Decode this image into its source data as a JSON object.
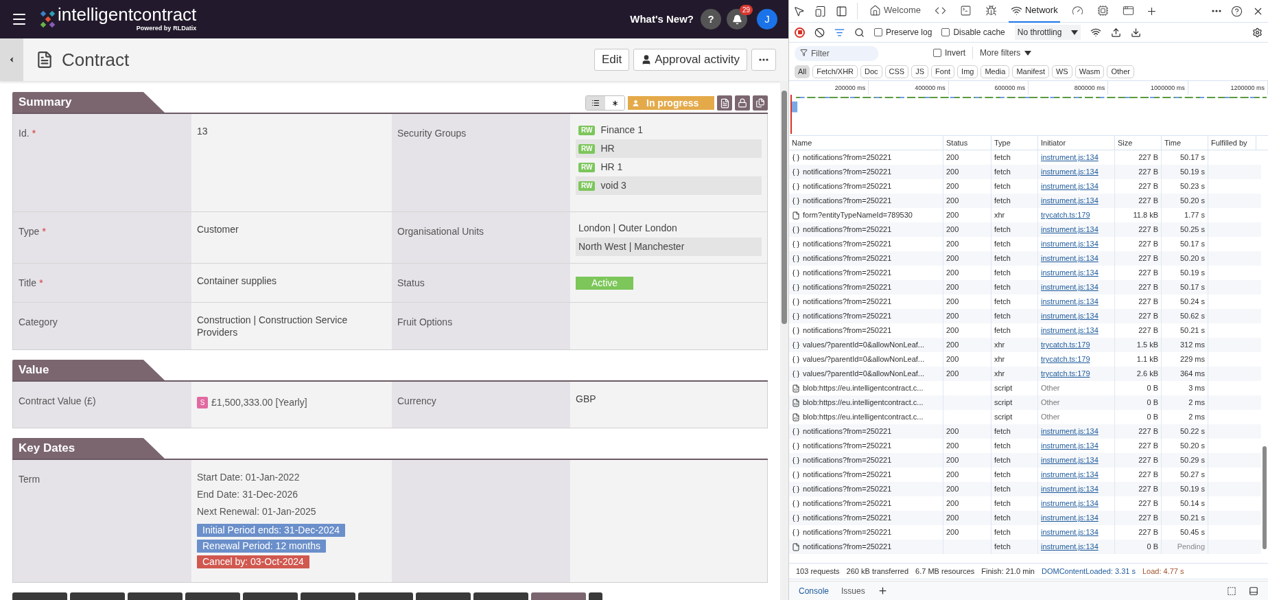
{
  "app_header": {
    "logo_text": "intelligentcontract",
    "powered_by": "Powered by",
    "brand": "RLDatix",
    "whats_new": "What's New?",
    "help": "?",
    "notification_count": "29",
    "avatar": "J"
  },
  "title_bar": {
    "title": "Contract",
    "buttons": [
      {
        "kind": "text",
        "label": "Edit"
      },
      {
        "kind": "approval",
        "label": "Approval activity"
      }
    ]
  },
  "summary_tools": {
    "views": [
      {
        "kind": "list",
        "selected": true
      },
      {
        "kind": "asterisk",
        "selected": false
      }
    ],
    "status_badge": "In progress"
  },
  "sections": [
    {
      "title": "Summary",
      "rows": [
        [
          {
            "label": "Id.",
            "required_mark": "*",
            "value": {
              "kind": "text",
              "text": "13"
            }
          },
          {
            "label": "Security Groups",
            "value": {
              "kind": "tags",
              "items": [
                {
                  "tag": "RW",
                  "name": "Finance 1"
                },
                {
                  "tag": "RW",
                  "name": "HR"
                },
                {
                  "tag": "RW",
                  "name": "HR 1"
                },
                {
                  "tag": "RW",
                  "name": "void 3"
                }
              ]
            }
          }
        ],
        [
          {
            "label": "Type",
            "required_mark": "*",
            "value": {
              "kind": "text",
              "text": "Customer"
            }
          },
          {
            "label": "Organisational Units",
            "value": {
              "kind": "list",
              "items": [
                "London | Outer London",
                "North West | Manchester"
              ]
            }
          }
        ],
        [
          {
            "label": "Title",
            "required_mark": "*",
            "value": {
              "kind": "text",
              "text": "Container supplies"
            }
          },
          {
            "label": "Status",
            "value": {
              "kind": "status",
              "text": "Active"
            }
          }
        ],
        [
          {
            "label": "Category",
            "value": {
              "kind": "text",
              "text": "Construction | Construction Service Providers"
            }
          },
          {
            "label": "Fruit Options"
          }
        ]
      ]
    },
    {
      "title": "Value",
      "rows": [
        [
          {
            "label": "Contract Value (£)",
            "value": {
              "kind": "money",
              "symbol": "S",
              "text": "£1,500,333.00 [Yearly]"
            }
          },
          {
            "label": "Currency",
            "value": {
              "kind": "text",
              "text": "GBP"
            }
          }
        ]
      ]
    },
    {
      "title": "Key Dates",
      "rows": [
        [
          {
            "label": "Term",
            "value": {
              "kind": "dates",
              "lines": [
                "Start Date: 01-Jan-2022",
                "End Date: 31-Dec-2026",
                "Next Renewal: 01-Jan-2025"
              ],
              "badges": [
                {
                  "text": "Initial Period ends: 31-Dec-2024",
                  "color": "#6a8fca"
                },
                {
                  "text": "Renewal Period: 12 months",
                  "color": "#6a8fca"
                },
                {
                  "text": "Cancel by: 03-Oct-2024",
                  "color": "#d0584f"
                }
              ]
            }
          }
        ]
      ]
    }
  ],
  "bottom_tabs": [
    {
      "selected": false
    },
    {
      "selected": false
    },
    {
      "selected": false
    },
    {
      "selected": false
    },
    {
      "selected": false
    },
    {
      "selected": false
    },
    {
      "selected": false
    },
    {
      "selected": false
    },
    {
      "selected": false
    },
    {
      "selected": true
    },
    {
      "selected": false
    }
  ],
  "devtools": {
    "panel_tabs": [
      {
        "kind": "welcome",
        "label": "Welcome",
        "selected": false
      },
      {
        "kind": "elements",
        "selected": false
      },
      {
        "kind": "console",
        "selected": false
      },
      {
        "kind": "sources",
        "selected": false
      },
      {
        "kind": "network",
        "label": "Network",
        "selected": true
      },
      {
        "kind": "performance",
        "selected": false
      },
      {
        "kind": "memory",
        "selected": false
      },
      {
        "kind": "application",
        "selected": false
      }
    ],
    "preserve_log": {
      "label": "Preserve log",
      "checked": false
    },
    "disable_cache": {
      "label": "Disable cache",
      "checked": false
    },
    "throttling": "No throttling",
    "filter_placeholder": "Filter",
    "invert": {
      "label": "Invert",
      "checked": false
    },
    "more_filters": "More filters",
    "type_filters": [
      {
        "label": "All",
        "selected": true
      },
      {
        "label": "Fetch/XHR",
        "selected": false
      },
      {
        "label": "Doc",
        "selected": false
      },
      {
        "label": "CSS",
        "selected": false
      },
      {
        "label": "JS",
        "selected": false
      },
      {
        "label": "Font",
        "selected": false
      },
      {
        "label": "Img",
        "selected": false
      },
      {
        "label": "Media",
        "selected": false
      },
      {
        "label": "Manifest",
        "selected": false
      },
      {
        "label": "WS",
        "selected": false
      },
      {
        "label": "Wasm",
        "selected": false
      },
      {
        "label": "Other",
        "selected": false
      }
    ],
    "overview_ticks": [
      "200000 ms",
      "400000 ms",
      "600000 ms",
      "800000 ms",
      "1000000 ms",
      "1200000 ms"
    ],
    "columns": [
      "Name",
      "Status",
      "Type",
      "Initiator",
      "Size",
      "Time",
      "Fulfilled by"
    ],
    "requests": [
      {
        "kind": "fetch",
        "name": "notifications?from=250221",
        "status": "200",
        "type": "fetch",
        "initiator": "instrument.js:134",
        "linked": true,
        "size": "227 B",
        "time": "50.17 s",
        "pending": false
      },
      {
        "kind": "fetch",
        "name": "notifications?from=250221",
        "status": "200",
        "type": "fetch",
        "initiator": "instrument.js:134",
        "linked": true,
        "size": "227 B",
        "time": "50.19 s",
        "pending": false
      },
      {
        "kind": "fetch",
        "name": "notifications?from=250221",
        "status": "200",
        "type": "fetch",
        "initiator": "instrument.js:134",
        "linked": true,
        "size": "227 B",
        "time": "50.23 s",
        "pending": false
      },
      {
        "kind": "fetch",
        "name": "notifications?from=250221",
        "status": "200",
        "type": "fetch",
        "initiator": "instrument.js:134",
        "linked": true,
        "size": "227 B",
        "time": "50.20 s",
        "pending": false
      },
      {
        "kind": "document",
        "name": "form?entityTypeNameId=789530",
        "status": "200",
        "type": "xhr",
        "initiator": "trycatch.ts:179",
        "linked": true,
        "size": "11.8 kB",
        "time": "1.77 s",
        "pending": false
      },
      {
        "kind": "fetch",
        "name": "notifications?from=250221",
        "status": "200",
        "type": "fetch",
        "initiator": "instrument.js:134",
        "linked": true,
        "size": "227 B",
        "time": "50.25 s",
        "pending": false
      },
      {
        "kind": "fetch",
        "name": "notifications?from=250221",
        "status": "200",
        "type": "fetch",
        "initiator": "instrument.js:134",
        "linked": true,
        "size": "227 B",
        "time": "50.17 s",
        "pending": false
      },
      {
        "kind": "fetch",
        "name": "notifications?from=250221",
        "status": "200",
        "type": "fetch",
        "initiator": "instrument.js:134",
        "linked": true,
        "size": "227 B",
        "time": "50.20 s",
        "pending": false
      },
      {
        "kind": "fetch",
        "name": "notifications?from=250221",
        "status": "200",
        "type": "fetch",
        "initiator": "instrument.js:134",
        "linked": true,
        "size": "227 B",
        "time": "50.19 s",
        "pending": false
      },
      {
        "kind": "fetch",
        "name": "notifications?from=250221",
        "status": "200",
        "type": "fetch",
        "initiator": "instrument.js:134",
        "linked": true,
        "size": "227 B",
        "time": "50.17 s",
        "pending": false
      },
      {
        "kind": "fetch",
        "name": "notifications?from=250221",
        "status": "200",
        "type": "fetch",
        "initiator": "instrument.js:134",
        "linked": true,
        "size": "227 B",
        "time": "50.24 s",
        "pending": false
      },
      {
        "kind": "fetch",
        "name": "notifications?from=250221",
        "status": "200",
        "type": "fetch",
        "initiator": "instrument.js:134",
        "linked": true,
        "size": "227 B",
        "time": "50.62 s",
        "pending": false
      },
      {
        "kind": "fetch",
        "name": "notifications?from=250221",
        "status": "200",
        "type": "fetch",
        "initiator": "instrument.js:134",
        "linked": true,
        "size": "227 B",
        "time": "50.21 s",
        "pending": false
      },
      {
        "kind": "fetch",
        "name": "values/?parentId=0&allowNonLeaf...",
        "status": "200",
        "type": "xhr",
        "initiator": "trycatch.ts:179",
        "linked": true,
        "size": "1.5 kB",
        "time": "312 ms",
        "pending": false
      },
      {
        "kind": "fetch",
        "name": "values/?parentId=0&allowNonLeaf...",
        "status": "200",
        "type": "xhr",
        "initiator": "trycatch.ts:179",
        "linked": true,
        "size": "1.1 kB",
        "time": "229 ms",
        "pending": false
      },
      {
        "kind": "fetch",
        "name": "values/?parentId=0&allowNonLeaf...",
        "status": "200",
        "type": "xhr",
        "initiator": "trycatch.ts:179",
        "linked": true,
        "size": "2.6 kB",
        "time": "364 ms",
        "pending": false
      },
      {
        "kind": "script",
        "name": "blob:https://eu.intelligentcontract.c...",
        "type": "script",
        "initiator": "Other",
        "linked": false,
        "size": "0 B",
        "time": "3 ms",
        "pending": false
      },
      {
        "kind": "script",
        "name": "blob:https://eu.intelligentcontract.c...",
        "type": "script",
        "initiator": "Other",
        "linked": false,
        "size": "0 B",
        "time": "2 ms",
        "pending": false
      },
      {
        "kind": "script",
        "name": "blob:https://eu.intelligentcontract.c...",
        "type": "script",
        "initiator": "Other",
        "linked": false,
        "size": "0 B",
        "time": "2 ms",
        "pending": false
      },
      {
        "kind": "fetch",
        "name": "notifications?from=250221",
        "status": "200",
        "type": "fetch",
        "initiator": "instrument.js:134",
        "linked": true,
        "size": "227 B",
        "time": "50.22 s",
        "pending": false
      },
      {
        "kind": "fetch",
        "name": "notifications?from=250221",
        "status": "200",
        "type": "fetch",
        "initiator": "instrument.js:134",
        "linked": true,
        "size": "227 B",
        "time": "50.20 s",
        "pending": false
      },
      {
        "kind": "fetch",
        "name": "notifications?from=250221",
        "status": "200",
        "type": "fetch",
        "initiator": "instrument.js:134",
        "linked": true,
        "size": "227 B",
        "time": "50.29 s",
        "pending": false
      },
      {
        "kind": "fetch",
        "name": "notifications?from=250221",
        "status": "200",
        "type": "fetch",
        "initiator": "instrument.js:134",
        "linked": true,
        "size": "227 B",
        "time": "50.27 s",
        "pending": false
      },
      {
        "kind": "fetch",
        "name": "notifications?from=250221",
        "status": "200",
        "type": "fetch",
        "initiator": "instrument.js:134",
        "linked": true,
        "size": "227 B",
        "time": "50.19 s",
        "pending": false
      },
      {
        "kind": "fetch",
        "name": "notifications?from=250221",
        "status": "200",
        "type": "fetch",
        "initiator": "instrument.js:134",
        "linked": true,
        "size": "227 B",
        "time": "50.14 s",
        "pending": false
      },
      {
        "kind": "fetch",
        "name": "notifications?from=250221",
        "status": "200",
        "type": "fetch",
        "initiator": "instrument.js:134",
        "linked": true,
        "size": "227 B",
        "time": "50.21 s",
        "pending": false
      },
      {
        "kind": "fetch",
        "name": "notifications?from=250221",
        "status": "200",
        "type": "fetch",
        "initiator": "instrument.js:134",
        "linked": true,
        "size": "227 B",
        "time": "50.45 s",
        "pending": false
      },
      {
        "kind": "document",
        "name": "notifications?from=250221",
        "type": "fetch",
        "initiator": "instrument.js:134",
        "linked": true,
        "size": "0 B",
        "time": "Pending",
        "pending": true
      }
    ],
    "summary": [
      {
        "text": "103 requests",
        "kind": "plain"
      },
      {
        "text": "260 kB transferred",
        "kind": "plain"
      },
      {
        "text": "6.7 MB resources",
        "kind": "plain"
      },
      {
        "text": "Finish: 21.0 min",
        "kind": "plain"
      },
      {
        "text": "DOMContentLoaded: 3.31 s",
        "kind": "dom"
      },
      {
        "text": "Load: 4.77 s",
        "kind": "load"
      }
    ],
    "drawer_tabs": [
      {
        "label": "Console",
        "selected": true
      },
      {
        "label": "Issues",
        "selected": false
      }
    ]
  }
}
